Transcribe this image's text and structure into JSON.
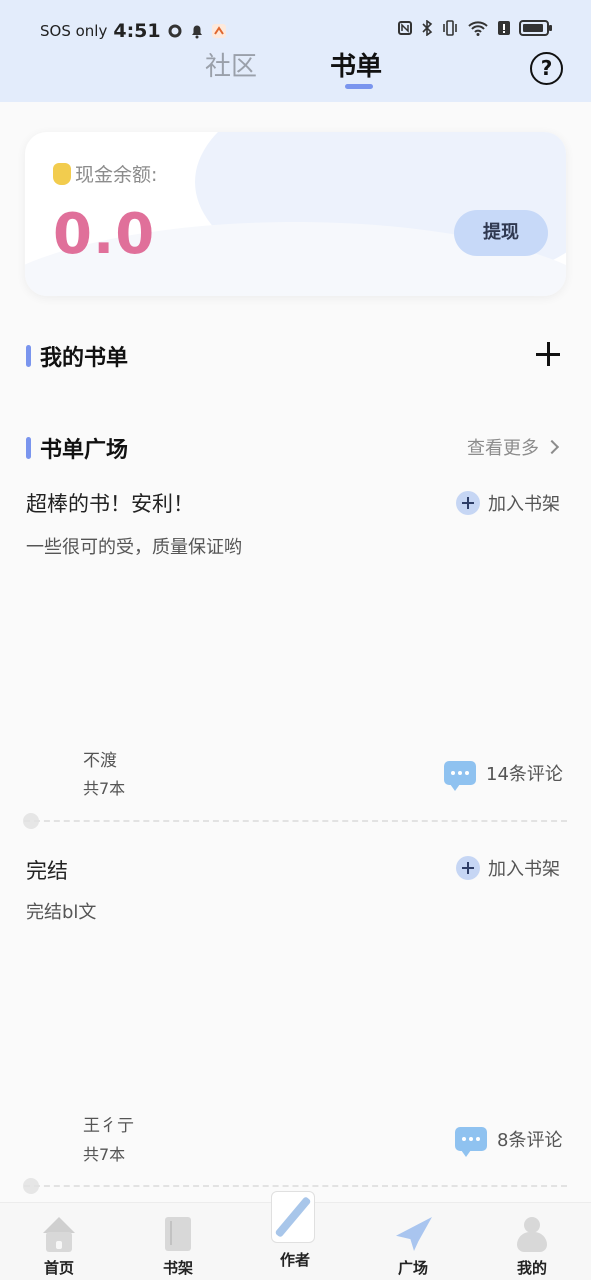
{
  "status_bar": {
    "carrier": "SOS only",
    "time": "4:51"
  },
  "header": {
    "tabs": [
      {
        "label": "社区",
        "active": false
      },
      {
        "label": "书单",
        "active": true
      }
    ],
    "help_icon": "question-circle-icon",
    "help_symbol": "?"
  },
  "cash_card": {
    "label": "现金余额:",
    "value": "0.0",
    "withdraw_label": "提现",
    "value_color": "#e0709a"
  },
  "my_lists": {
    "title": "我的书单",
    "add_icon": "plus-icon"
  },
  "plaza": {
    "title": "书单广场",
    "more_label": "查看更多",
    "lists": [
      {
        "title": "超棒的书！安利！",
        "description": "一些很可的受，质量保证哟",
        "author": "不渡",
        "count": "共7本",
        "add_label": "加入书架",
        "comments": "14条评论"
      },
      {
        "title": "完结",
        "description": "完结bl文",
        "author": "王彳亍",
        "count": "共7本",
        "add_label": "加入书架",
        "comments": "8条评论"
      }
    ]
  },
  "bottom_nav": [
    {
      "label": "首页",
      "icon": "home-icon"
    },
    {
      "label": "书架",
      "icon": "bookshelf-icon"
    },
    {
      "label": "作者",
      "icon": "author-pen-icon"
    },
    {
      "label": "广场",
      "icon": "paper-plane-icon",
      "active": true
    },
    {
      "label": "我的",
      "icon": "user-icon"
    }
  ],
  "colors": {
    "accent": "#7a95ee",
    "header_bg": "#e3ecfb",
    "withdraw_bg": "#c7d9f8"
  }
}
